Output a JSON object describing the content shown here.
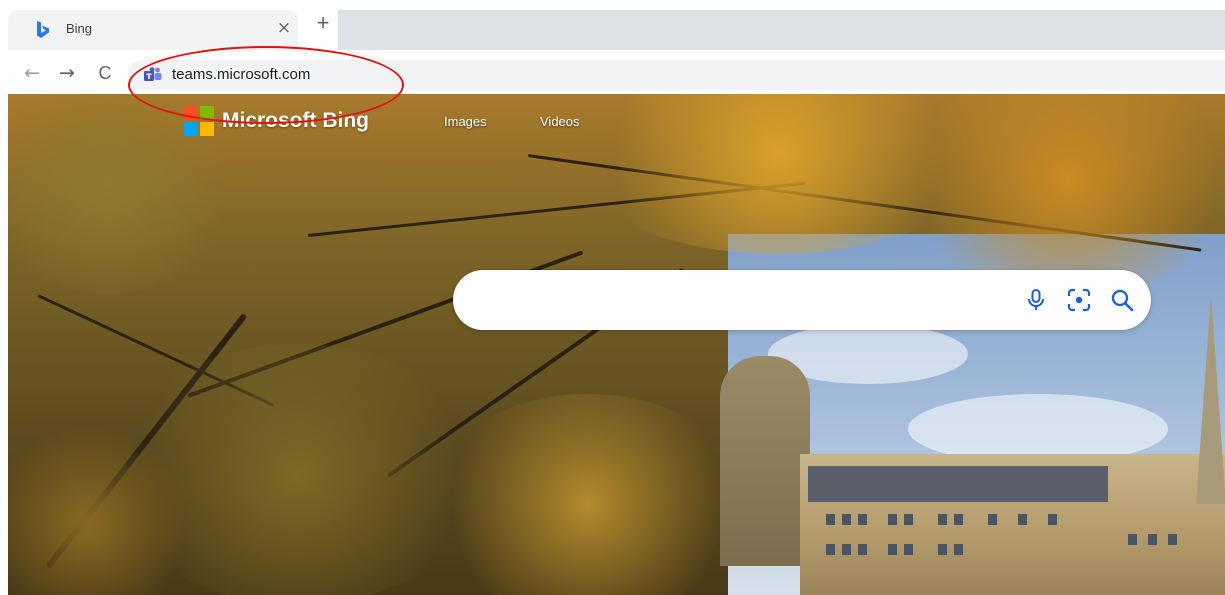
{
  "browser": {
    "tab": {
      "title": "Bing",
      "favicon": "bing-icon",
      "close_label": "×"
    },
    "new_tab_label": "+",
    "nav": {
      "back_label": "←",
      "forward_label": "→",
      "reload_label": "C"
    },
    "omnibox": {
      "site_icon": "teams-icon",
      "url": "teams.microsoft.com"
    },
    "annotation": {
      "shape": "ellipse",
      "color": "#e21313",
      "target": "omnibox-url"
    }
  },
  "bing": {
    "brand": "Microsoft Bing",
    "logo_colors": [
      "#f25022",
      "#7fba00",
      "#00a4ef",
      "#ffb900"
    ],
    "nav_links": [
      "Images",
      "Videos"
    ],
    "search": {
      "placeholder": "",
      "icons": [
        "microphone-icon",
        "visual-search-icon",
        "search-icon"
      ],
      "accent": "#1a5fd6"
    }
  }
}
